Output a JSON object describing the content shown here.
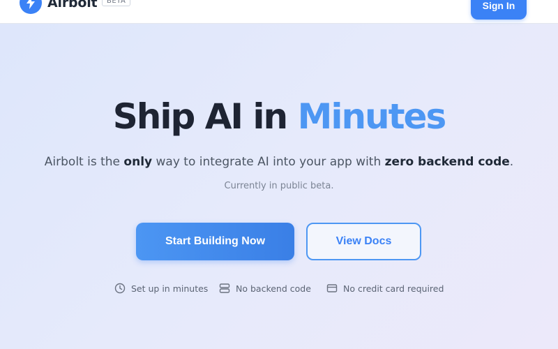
{
  "header": {
    "logo_text": "Airbolt",
    "badge": "BETA",
    "signin_label": "Sign In",
    "logo_icon": "lightning-bolt-icon"
  },
  "hero": {
    "title_main": "Ship AI in ",
    "title_accent": "Minutes",
    "subtitle": {
      "part1": "Airbolt is the ",
      "bold1": "only",
      "part2": " way to integrate AI into your app with ",
      "bold2": "zero backend code",
      "part3": "."
    },
    "note": "Currently in public beta."
  },
  "actions": {
    "primary_label": "Start Building Now",
    "secondary_label": "View Docs"
  },
  "features": [
    {
      "icon": "clock-icon",
      "label": "Set up in minutes"
    },
    {
      "icon": "server-icon",
      "label": "No backend code"
    },
    {
      "icon": "credit-card-icon",
      "label": "No credit card required"
    }
  ],
  "colors": {
    "accent": "#3b82f6",
    "title_accent": "#4d97f3",
    "text_dark": "#1e2433"
  }
}
